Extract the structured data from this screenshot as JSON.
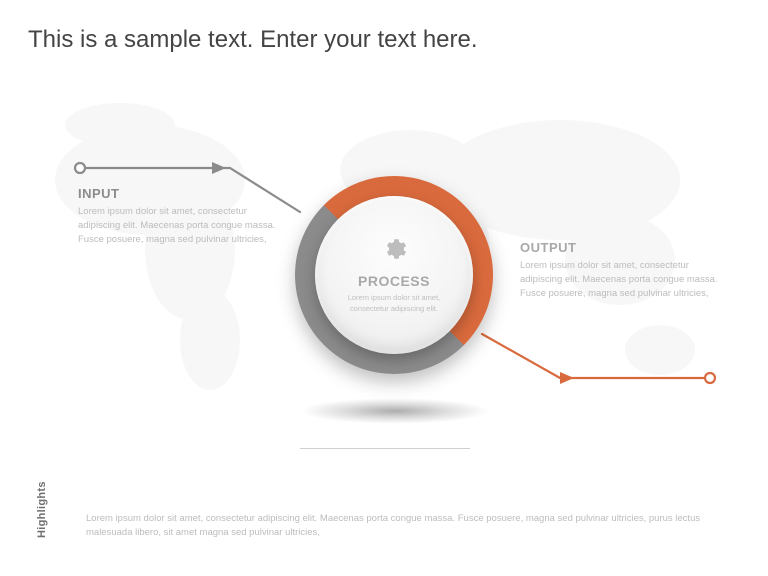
{
  "title": "This is a sample text. Enter your text here.",
  "input": {
    "label": "INPUT",
    "body": "Lorem ipsum dolor sit amet, consectetur adipiscing elit. Maecenas porta congue massa. Fusce posuere, magna sed pulvinar ultricies,"
  },
  "process": {
    "icon": "gear-icon",
    "label": "PROCESS",
    "body": "Lorem ipsum dolor sit amet, consectetur adipiscing elit."
  },
  "output": {
    "label": "OUTPUT",
    "body": "Lorem ipsum dolor sit amet, consectetur adipiscing elit. Maecenas porta congue massa. Fusce posuere, magna sed pulvinar ultricies,"
  },
  "highlights": {
    "label": "Highlights",
    "body": "Lorem ipsum dolor sit amet, consectetur adipiscing elit. Maecenas porta congue massa. Fusce posuere, magna sed pulvinar ultricies, purus lectus malesuada libero, sit amet magna sed pulvinar ultricies,"
  },
  "colors": {
    "accent_orange": "#d96a3d",
    "accent_gray": "#8b8b8b",
    "text_muted": "#bcbcbc"
  }
}
